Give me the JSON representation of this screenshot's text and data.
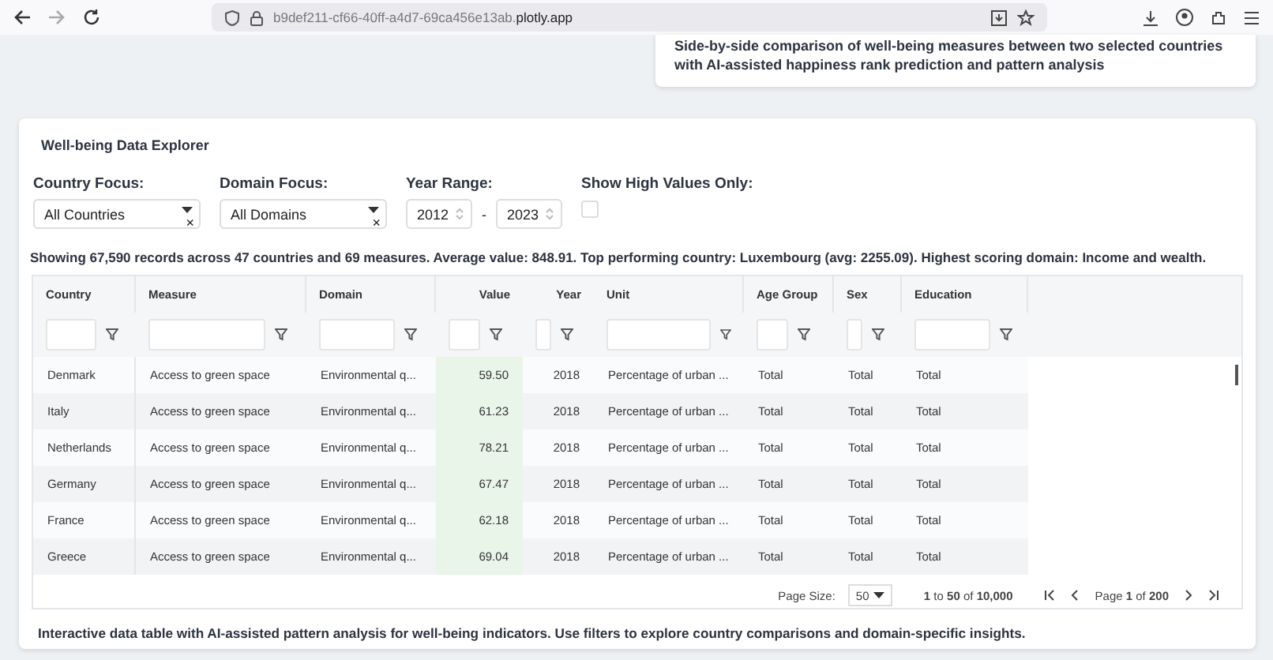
{
  "browser": {
    "url_prefix": "b9def211-cf66-40ff-a4d7-69ca456e13ab.",
    "url_domain": "plotly.app"
  },
  "comparison_card": {
    "description": "Side-by-side comparison of well-being measures between two selected countries with AI-assisted happiness rank prediction and pattern analysis"
  },
  "explorer": {
    "title": "Well-being Data Explorer",
    "country_focus": {
      "label": "Country Focus:",
      "value": "All Countries",
      "clear": "×"
    },
    "domain_focus": {
      "label": "Domain Focus:",
      "value": "All Domains",
      "clear": "×"
    },
    "year_range": {
      "label": "Year Range:",
      "from": "2012",
      "separator": "-",
      "to": "2023"
    },
    "show_high_values": {
      "label": "Show High Values Only:",
      "checked": false
    },
    "summary": "Showing 67,590 records across 47 countries and 69 measures. Average value: 848.91. Top performing country: Luxembourg (avg: 2255.09). Highest scoring domain: Income and wealth.",
    "table": {
      "columns": [
        {
          "label": "Country",
          "kind": "text"
        },
        {
          "label": "Measure",
          "kind": "text"
        },
        {
          "label": "Domain",
          "kind": "text"
        },
        {
          "label": "Value",
          "kind": "number"
        },
        {
          "label": "Year",
          "kind": "number"
        },
        {
          "label": "Unit",
          "kind": "text"
        },
        {
          "label": "Age Group",
          "kind": "text"
        },
        {
          "label": "Sex",
          "kind": "text"
        },
        {
          "label": "Education",
          "kind": "text"
        }
      ],
      "rows": [
        [
          "Denmark",
          "Access to green space",
          "Environmental q...",
          "59.50",
          "2018",
          "Percentage of urban ...",
          "Total",
          "Total",
          "Total"
        ],
        [
          "Italy",
          "Access to green space",
          "Environmental q...",
          "61.23",
          "2018",
          "Percentage of urban ...",
          "Total",
          "Total",
          "Total"
        ],
        [
          "Netherlands",
          "Access to green space",
          "Environmental q...",
          "78.21",
          "2018",
          "Percentage of urban ...",
          "Total",
          "Total",
          "Total"
        ],
        [
          "Germany",
          "Access to green space",
          "Environmental q...",
          "67.47",
          "2018",
          "Percentage of urban ...",
          "Total",
          "Total",
          "Total"
        ],
        [
          "France",
          "Access to green space",
          "Environmental q...",
          "62.18",
          "2018",
          "Percentage of urban ...",
          "Total",
          "Total",
          "Total"
        ],
        [
          "Greece",
          "Access to green space",
          "Environmental q...",
          "69.04",
          "2018",
          "Percentage of urban ...",
          "Total",
          "Total",
          "Total"
        ]
      ]
    },
    "pagination": {
      "page_size_label": "Page Size:",
      "page_size": "50",
      "range": "**1** to **50** of **10,000**",
      "page": "Page **1** of **200**"
    },
    "footer": "Interactive data table with AI-assisted pattern analysis for well-being indicators. Use filters to explore country comparisons and domain-specific insights."
  }
}
